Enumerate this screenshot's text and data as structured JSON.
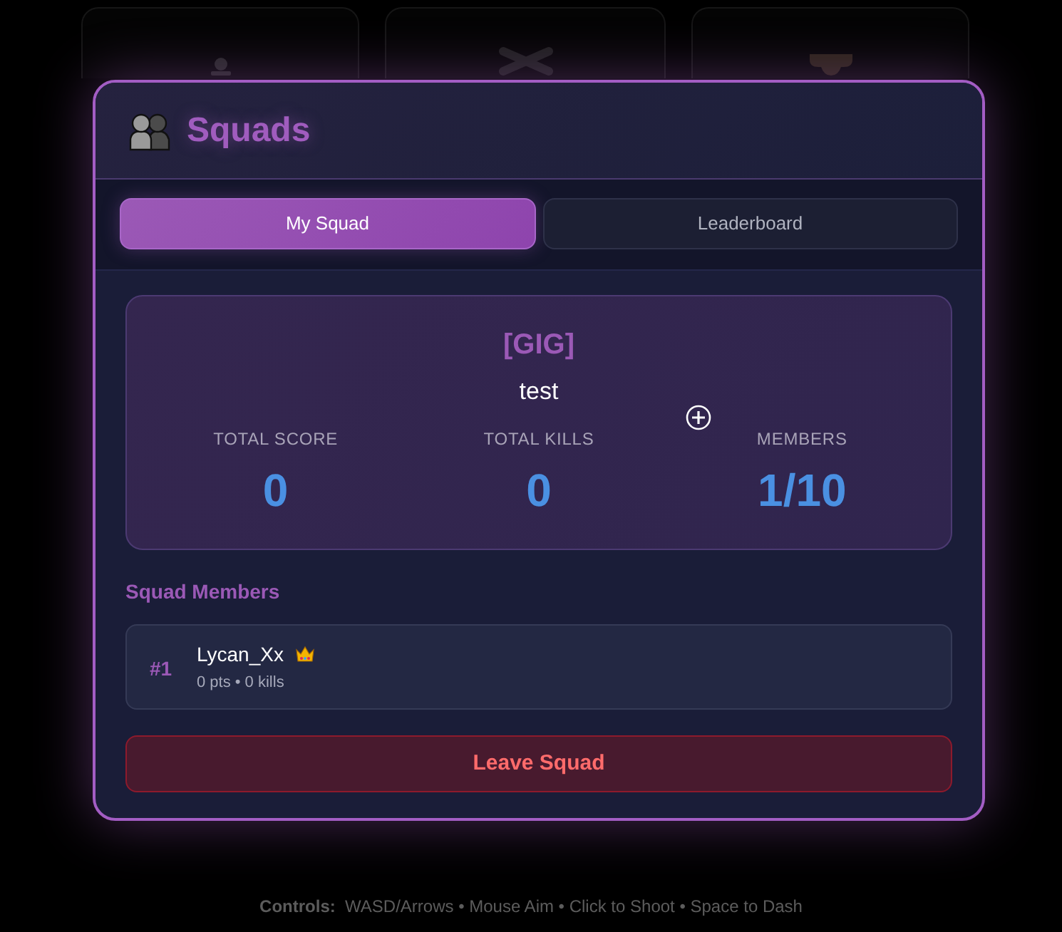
{
  "modal": {
    "title": "Squads"
  },
  "tabs": [
    {
      "label": "My Squad",
      "selected": true
    },
    {
      "label": "Leaderboard",
      "selected": false
    }
  ],
  "squad": {
    "tag": "[GIG]",
    "name": "test",
    "stats": [
      {
        "label": "TOTAL SCORE",
        "value": "0"
      },
      {
        "label": "TOTAL KILLS",
        "value": "0"
      },
      {
        "label": "MEMBERS",
        "value": "1/10"
      }
    ]
  },
  "members_section": {
    "heading": "Squad Members",
    "members": [
      {
        "rank": "#1",
        "name": "Lycan_Xx",
        "leader": true,
        "stats": "0 pts • 0 kills"
      }
    ]
  },
  "leave_button": {
    "label": "Leave Squad"
  },
  "footer": {
    "text": "**Controls:**  WASD/Arrows • Mouse Aim • Click to Shoot • Space to Dash"
  }
}
